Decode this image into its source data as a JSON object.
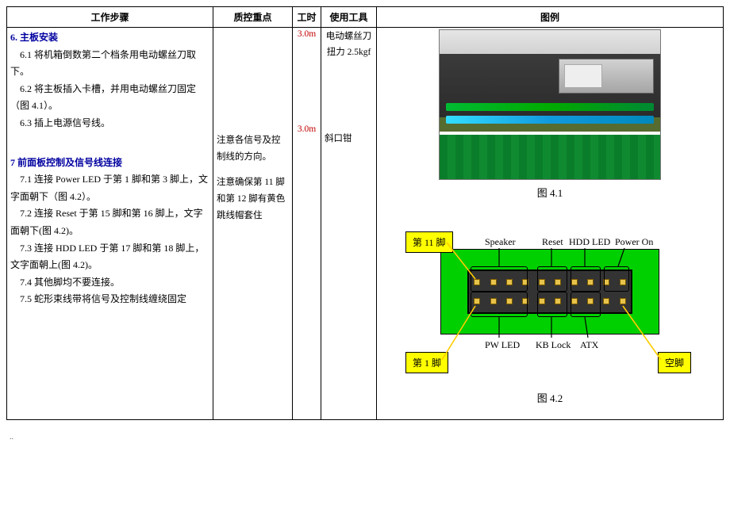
{
  "columns": {
    "steps": "工作步骤",
    "qc": "质控重点",
    "hours": "工时",
    "tools": "使用工具",
    "figs": "图例"
  },
  "step6": {
    "title": "6. 主板安装",
    "p1": "6.1 将机箱倒数第二个档条用电动螺丝刀取下。",
    "p2": "6.2 将主板插入卡槽，并用电动螺丝刀固定（图 4.1）。",
    "p3": "6.3 插上电源信号线。",
    "hours": "3.0m",
    "tool1": "电动螺丝刀",
    "tool2": "扭力 2.5kgf"
  },
  "step7": {
    "title": "7 前面板控制及信号线连接",
    "p1": "7.1 连接 Power LED 于第 1 脚和第 3 脚上，文字面朝下（图 4.2）。",
    "p2": "7.2 连接 Reset 于第 15 脚和第 16 脚上，文字面朝下(图 4.2)。",
    "p3": "7.3 连接 HDD LED 于第 17 脚和第 18 脚上，文字面朝上(图 4.2)。",
    "p4": "7.4 其他脚均不要连接。",
    "p5": "7.5 蛇形束线带将信号及控制线缠绕固定",
    "qc1": "注意各信号及控制线的方向。",
    "qc2": "注意确保第 11 脚和第 12 脚有黄色跳线帽套住",
    "hours": "3.0m",
    "tool1": "斜口钳"
  },
  "fig41": "图 4.1",
  "fig42": "图 4.2",
  "diagram": {
    "pin11": "第 11 脚",
    "pin1": "第 1 脚",
    "empty": "空脚",
    "speaker": "Speaker",
    "reset": "Reset",
    "hdd": "HDD LED",
    "poweron": "Power On",
    "pwled": "PW LED",
    "kblock": "KB Lock",
    "atx": "ATX"
  },
  "footer": ".."
}
